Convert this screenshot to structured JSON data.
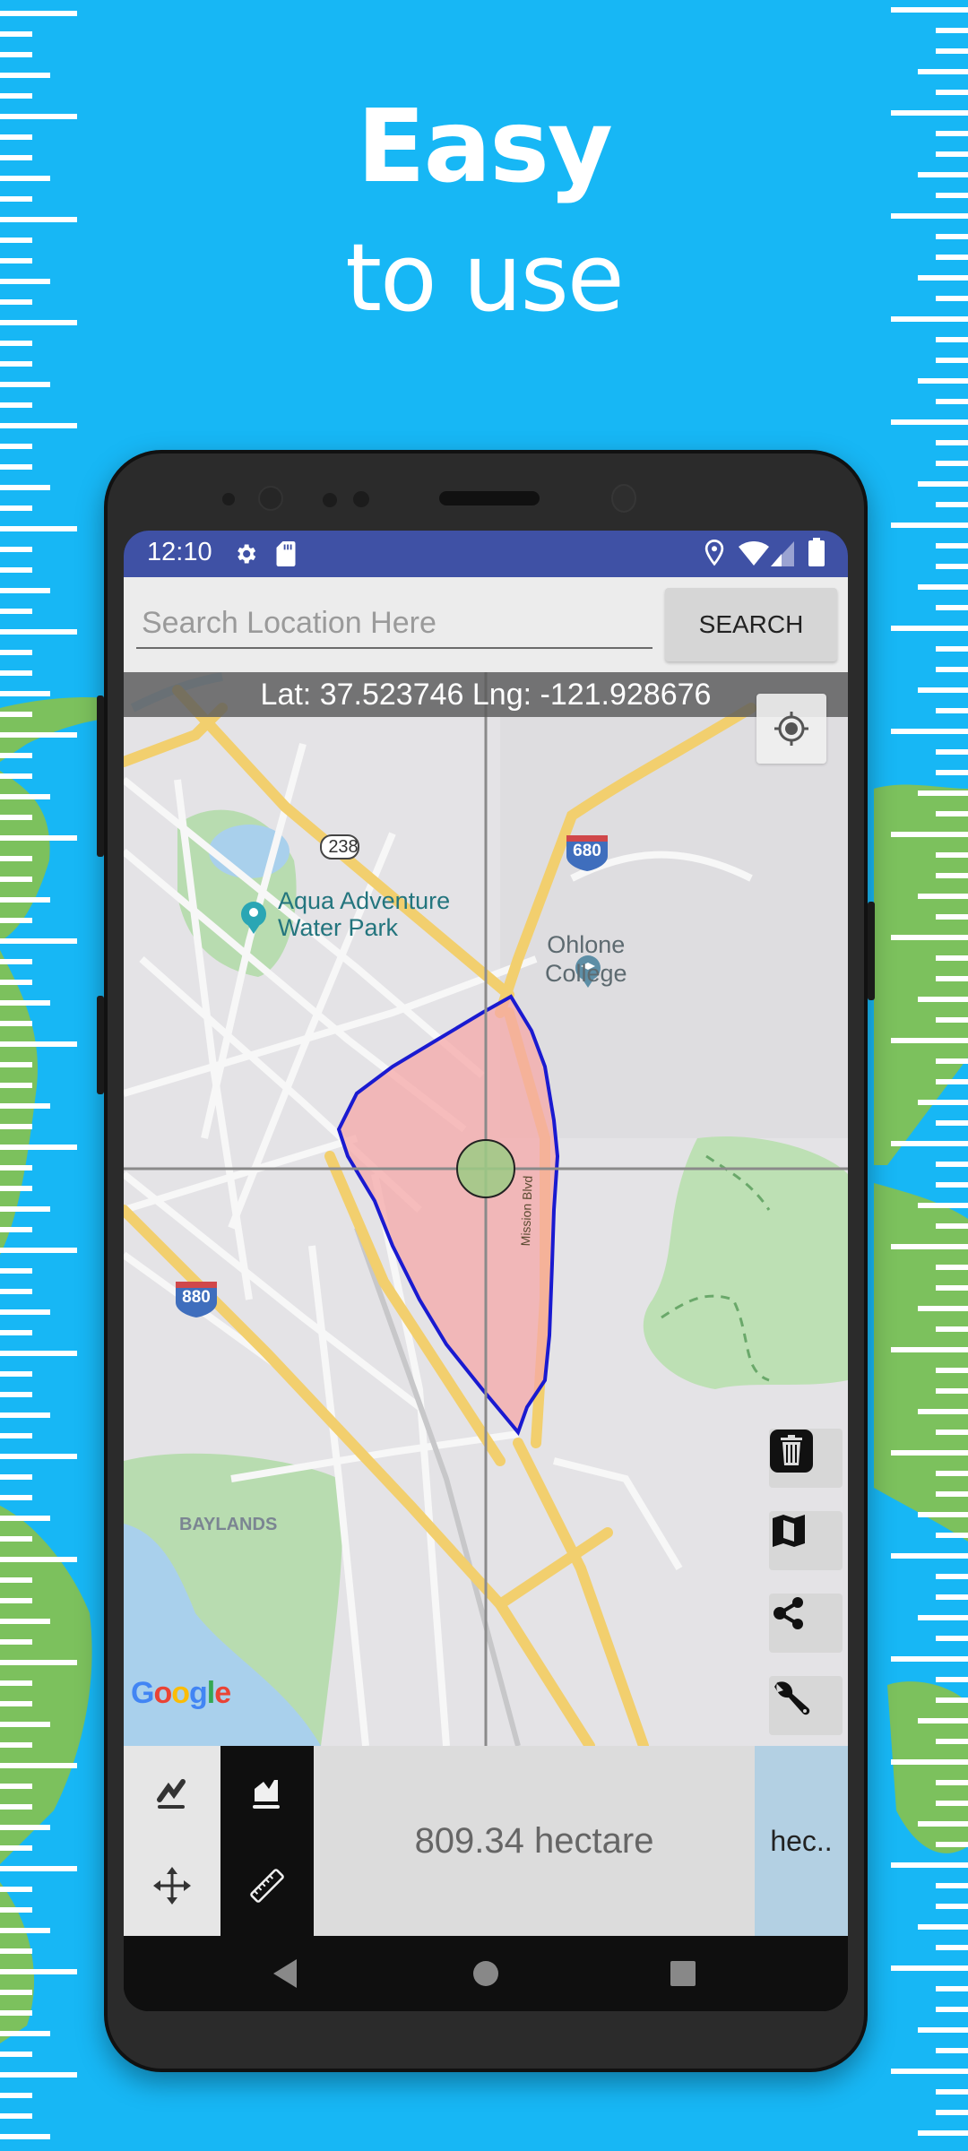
{
  "promo": {
    "headline_line1": "Easy",
    "headline_line2": "to use",
    "background_color": "#17b7f5"
  },
  "statusbar": {
    "time": "12:10",
    "left_icons": [
      "settings-icon",
      "sd-card-icon"
    ],
    "right_icons": [
      "location-pin-icon",
      "wifi-icon",
      "signal-icon",
      "battery-icon"
    ],
    "color": "#3f51a5"
  },
  "search": {
    "placeholder": "Search Location Here",
    "value": "",
    "button_label": "SEARCH"
  },
  "map": {
    "coordinates_text": "Lat: 37.523746 Lng: -121.928676",
    "labels": {
      "aqua_line1": "Aqua Adventure",
      "aqua_line2": "Water Park",
      "ohlone_line1": "Ohlone",
      "ohlone_line2": "College",
      "baylands": "BAYLANDS",
      "mission_blvd": "Mission Blvd",
      "route_238": "238",
      "route_680": "680",
      "route_880": "880"
    },
    "google_logo": [
      "G",
      "o",
      "o",
      "g",
      "l",
      "e"
    ],
    "polygon": {
      "fill": "#f5a8a8",
      "stroke": "#1a1ad0"
    },
    "side_buttons": [
      {
        "name": "delete",
        "icon": "trash-icon"
      },
      {
        "name": "map-type",
        "icon": "folded-map-icon"
      },
      {
        "name": "share",
        "icon": "share-icon"
      },
      {
        "name": "settings",
        "icon": "wrench-icon"
      }
    ]
  },
  "tools": {
    "line_mode": "line-measure-icon",
    "area_mode": "area-measure-icon",
    "move_mode": "move-icon",
    "ruler_mode": "ruler-icon",
    "active": "area"
  },
  "result": {
    "area_text": "809.34 hectare",
    "unit_button_label": "hec.."
  },
  "navbar": {
    "buttons": [
      "back-icon",
      "home-icon",
      "recents-icon"
    ]
  }
}
